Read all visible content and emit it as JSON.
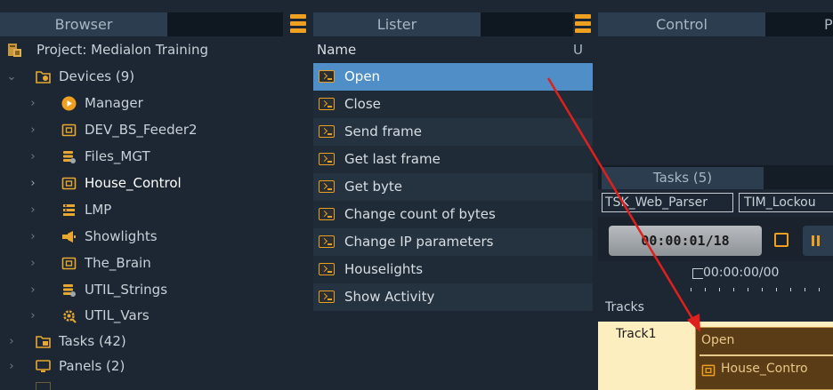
{
  "browser": {
    "title": "Browser",
    "tree": [
      {
        "label": "Project: Medialon Training",
        "icon": "project-icon"
      },
      {
        "label": "Devices (9)",
        "icon": "devices-folder-icon"
      },
      {
        "label": "Manager",
        "icon": "manager-icon"
      },
      {
        "label": "DEV_BS_Feeder2",
        "icon": "device-icon"
      },
      {
        "label": "Files_MGT",
        "icon": "files-icon"
      },
      {
        "label": "House_Control",
        "icon": "device-icon"
      },
      {
        "label": "LMP",
        "icon": "lmp-icon"
      },
      {
        "label": "Showlights",
        "icon": "showlights-icon"
      },
      {
        "label": "The_Brain",
        "icon": "device-icon"
      },
      {
        "label": "UTIL_Strings",
        "icon": "strings-icon"
      },
      {
        "label": "UTIL_Vars",
        "icon": "vars-icon"
      },
      {
        "label": "Tasks (42)",
        "icon": "tasks-folder-icon"
      },
      {
        "label": "Panels (2)",
        "icon": "panels-icon"
      }
    ]
  },
  "lister": {
    "title": "Lister",
    "col_name": "Name",
    "col_u": "U",
    "items": [
      "Open",
      "Close",
      "Send frame",
      "Get last frame",
      "Get byte",
      "Change count of bytes",
      "Change IP parameters",
      "Houselights",
      "Show Activity"
    ],
    "selected_index": 0
  },
  "control": {
    "title": "Control",
    "tab2": "P"
  },
  "tasks": {
    "title": "Tasks (5)",
    "task_tab_1": "TSK_Web_Parser",
    "task_tab_2": "TIM_Lockou",
    "timecode": "00:00:01/18",
    "ruler_time": "00:00:00/00",
    "tracks_label": "Tracks",
    "track_name": "Track1",
    "cue_title": "Open",
    "cue_device": "House_Contro"
  },
  "colors": {
    "accent": "#f0a020",
    "selection": "#4f8ec6",
    "arrow": "#e0201c"
  }
}
